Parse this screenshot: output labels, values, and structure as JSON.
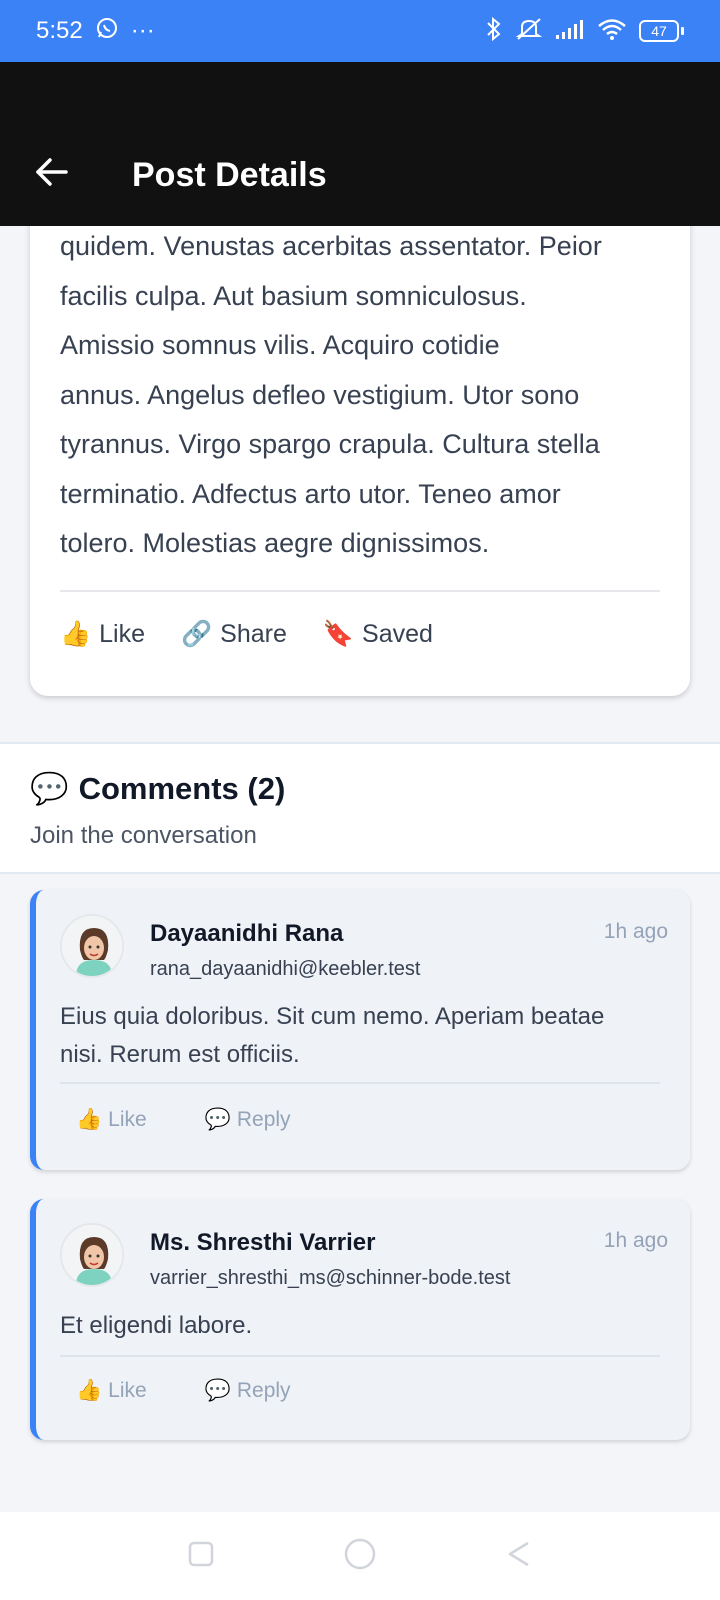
{
  "status_bar": {
    "time": "5:52",
    "overflow": "···",
    "battery": "47",
    "icons": [
      "whatsapp-icon",
      "bluetooth-icon",
      "mute-icon",
      "signal-icon",
      "wifi-icon",
      "battery-icon"
    ]
  },
  "app_bar": {
    "title": "Post Details",
    "back_icon": "arrow-left-icon"
  },
  "post": {
    "lines": [
      "quidem. Venustas acerbitas assentator. Peior",
      "facilis culpa. Aut basium somniculosus.",
      "Amissio somnus vilis. Acquiro cotidie",
      "annus. Angelus defleo vestigium. Utor sono",
      "tyrannus. Virgo spargo crapula. Cultura stella",
      "terminatio. Adfectus arto utor. Teneo amor",
      "tolero. Molestias aegre dignissimos."
    ],
    "actions": {
      "like": "Like",
      "share": "Share",
      "saved": "Saved"
    }
  },
  "comments": {
    "title": "Comments (2)",
    "subtitle": "Join the conversation",
    "items": [
      {
        "name": "Dayaanidhi Rana",
        "email": "rana_dayaanidhi@keebler.test",
        "time": "1h ago",
        "text_lines": [
          "Eius quia doloribus. Sit cum nemo. Aperiam beatae",
          "nisi. Rerum est officiis."
        ],
        "like": "Like",
        "reply": "Reply"
      },
      {
        "name": "Ms. Shresthi Varrier",
        "email": "varrier_shresthi_ms@schinner-bode.test",
        "time": "1h ago",
        "text_lines": [
          "Et eligendi labore."
        ],
        "like": "Like",
        "reply": "Reply"
      }
    ]
  },
  "colors": {
    "accent": "#3b82f6",
    "app_bar": "#111111",
    "muted": "#94a3b8"
  }
}
